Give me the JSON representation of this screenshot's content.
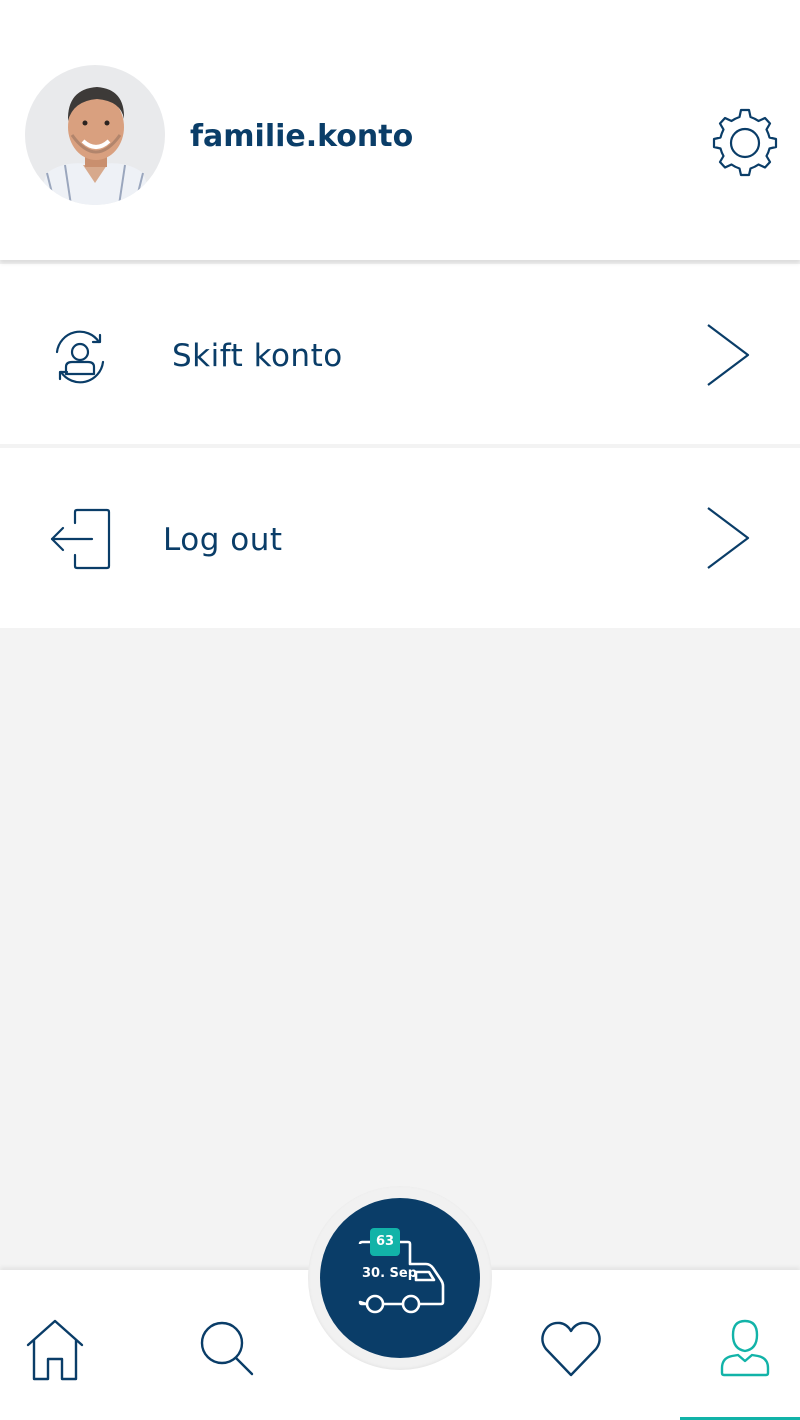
{
  "header": {
    "username": "familie.konto",
    "avatar_icon": "user-photo",
    "settings_icon": "gear-icon"
  },
  "menu": {
    "items": [
      {
        "label": "Skift konto",
        "icon": "switch-account-icon"
      },
      {
        "label": "Log out",
        "icon": "logout-icon"
      }
    ]
  },
  "delivery": {
    "count": "63",
    "date": "30. Sep",
    "icon": "truck-icon"
  },
  "bottom_nav": {
    "items": [
      {
        "icon": "home-icon",
        "active": false
      },
      {
        "icon": "search-icon",
        "active": false
      },
      {
        "icon": "heart-icon",
        "active": false
      },
      {
        "icon": "profile-icon",
        "active": true
      }
    ]
  },
  "colors": {
    "primary": "#0a3d68",
    "accent": "#12b3a8",
    "background": "#f3f3f3",
    "surface": "#ffffff"
  }
}
